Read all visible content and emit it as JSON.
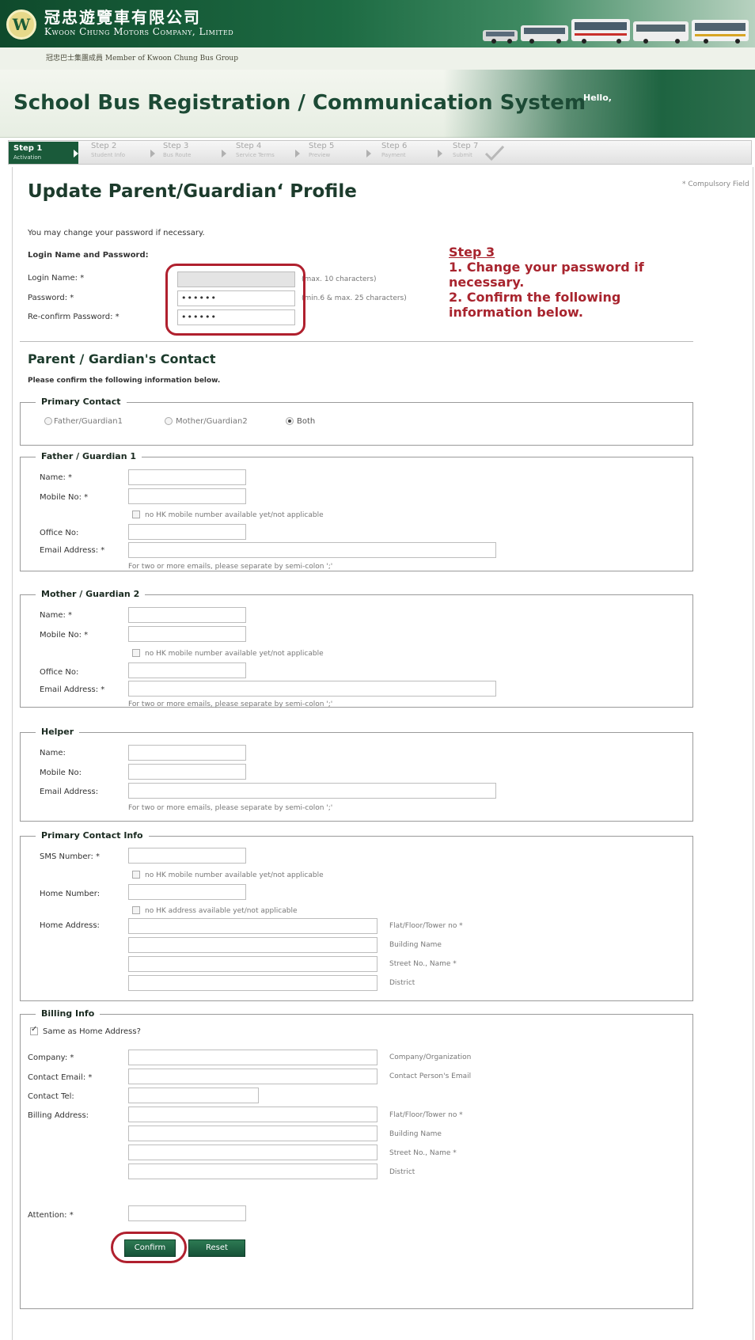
{
  "header": {
    "logo_letter": "W",
    "cn_name": "冠忠遊覽車有限公司",
    "en_name": "Kwoon Chung Motors Company, Limited",
    "group_line": "冠忠巴士集團成員  Member of Kwoon Chung Bus Group"
  },
  "app": {
    "title": "School Bus Registration / Communication System",
    "greeting": "Hello,"
  },
  "steps": [
    {
      "label": "Step 1",
      "sub": "Activation"
    },
    {
      "label": "Step 2",
      "sub": "Student Info"
    },
    {
      "label": "Step 3",
      "sub": "Bus Route"
    },
    {
      "label": "Step 4",
      "sub": "Service Terms"
    },
    {
      "label": "Step 5",
      "sub": "Preview"
    },
    {
      "label": "Step 6",
      "sub": "Payment"
    },
    {
      "label": "Step 7",
      "sub": "Submit"
    }
  ],
  "page": {
    "title": "Update Parent/Guardian‘ Profile",
    "compulsory_note": "* Compulsory Field",
    "intro": "You may change your password if necessary.",
    "login_heading": "Login Name and Password:",
    "login_label": "Login Name: *",
    "login_value": "",
    "login_hint": "(max. 10 characters)",
    "password_label": "Password: *",
    "password_value": "••••••",
    "password_hint": "(min.6 & max. 25 characters)",
    "reconfirm_label": "Re-confirm Password: *",
    "reconfirm_value": "••••••",
    "contact_heading": "Parent / Gardian's Contact",
    "contact_intro": "Please confirm the following information below."
  },
  "annotation": {
    "title": "Step 3",
    "line1": "1. Change your password if",
    "line2": "necessary.",
    "line3": "2. Confirm the following",
    "line4": "information below."
  },
  "primary_contact": {
    "legend": "Primary Contact",
    "options": [
      "Father/Guardian1",
      "Mother/Guardian2",
      "Both"
    ],
    "selected": "Both"
  },
  "father": {
    "legend": "Father / Guardian 1",
    "name_label": "Name: *",
    "mobile_label": "Mobile No: *",
    "no_mobile": "no HK mobile number available yet/not applicable",
    "office_label": "Office No:",
    "email_label": "Email Address: *",
    "email_note": "For two or more emails, please separate by semi-colon ';'"
  },
  "mother": {
    "legend": "Mother / Guardian 2",
    "name_label": "Name: *",
    "mobile_label": "Mobile No: *",
    "no_mobile": "no HK mobile number available yet/not applicable",
    "office_label": "Office No:",
    "email_label": "Email Address: *",
    "email_note": "For two or more emails, please separate by semi-colon ';'"
  },
  "helper": {
    "legend": "Helper",
    "name_label": "Name:",
    "mobile_label": "Mobile No:",
    "email_label": "Email Address:",
    "email_note": "For two or more emails, please separate by semi-colon ';'"
  },
  "primary_info": {
    "legend": "Primary Contact Info",
    "sms_label": "SMS Number: *",
    "no_mobile": "no HK mobile number available yet/not applicable",
    "home_label": "Home Number:",
    "no_address": "no HK address available yet/not applicable",
    "address_label": "Home Address:",
    "address_hints": [
      "Flat/Floor/Tower no *",
      "Building Name",
      "Street No., Name *",
      "District"
    ]
  },
  "billing": {
    "legend": "Billing Info",
    "same_label": "Same as Home Address?",
    "company_label": "Company: *",
    "company_hint": "Company/Organization",
    "email_label": "Contact Email: *",
    "email_hint": "Contact Person's Email",
    "tel_label": "Contact Tel:",
    "address_label": "Billing Address:",
    "address_hints": [
      "Flat/Floor/Tower no *",
      "Building Name",
      "Street No., Name *",
      "District"
    ],
    "attention_label": "Attention: *"
  },
  "buttons": {
    "confirm": "Confirm",
    "reset": "Reset"
  }
}
